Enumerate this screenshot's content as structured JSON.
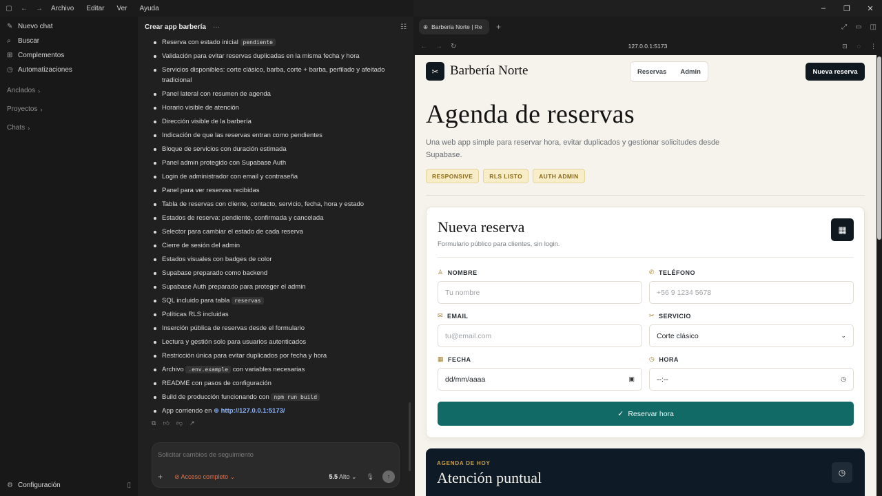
{
  "menubar": {
    "items": [
      "Archivo",
      "Editar",
      "Ver",
      "Ayuda"
    ]
  },
  "sidebar": {
    "items": [
      {
        "label": "Nuevo chat",
        "icon": "edit-icon"
      },
      {
        "label": "Buscar",
        "icon": "search-icon"
      },
      {
        "label": "Complementos",
        "icon": "grid-icon"
      },
      {
        "label": "Automatizaciones",
        "icon": "clock-icon"
      }
    ],
    "sections": [
      "Anclados",
      "Proyectos",
      "Chats"
    ],
    "settings_label": "Configuración"
  },
  "chat": {
    "title": "Crear app barbería",
    "bullets": [
      {
        "text": "Reserva con estado inicial ",
        "code": "pendiente"
      },
      {
        "text": "Validación para evitar reservas duplicadas en la misma fecha y hora"
      },
      {
        "text": "Servicios disponibles: corte clásico, barba, corte + barba, perfilado y afeitado tradicional"
      },
      {
        "text": "Panel lateral con resumen de agenda"
      },
      {
        "text": "Horario visible de atención"
      },
      {
        "text": "Dirección visible de la barbería"
      },
      {
        "text": "Indicación de que las reservas entran como pendientes"
      },
      {
        "text": "Bloque de servicios con duración estimada"
      },
      {
        "text": "Panel admin protegido con Supabase Auth"
      },
      {
        "text": "Login de administrador con email y contraseña"
      },
      {
        "text": "Panel para ver reservas recibidas"
      },
      {
        "text": "Tabla de reservas con cliente, contacto, servicio, fecha, hora y estado"
      },
      {
        "text": "Estados de reserva: pendiente, confirmada y cancelada"
      },
      {
        "text": "Selector para cambiar el estado de cada reserva"
      },
      {
        "text": "Cierre de sesión del admin"
      },
      {
        "text": "Estados visuales con badges de color"
      },
      {
        "text": "Supabase preparado como backend"
      },
      {
        "text": "Supabase Auth preparado para proteger el admin"
      },
      {
        "text": "SQL incluido para tabla ",
        "code": "reservas"
      },
      {
        "text": "Políticas RLS incluidas"
      },
      {
        "text": "Inserción pública de reservas desde el formulario"
      },
      {
        "text": "Lectura y gestión solo para usuarios autenticados"
      },
      {
        "text": "Restricción única para evitar duplicados por fecha y hora"
      },
      {
        "text": "Archivo ",
        "code": ".env.example",
        "after": " con variables necesarias"
      },
      {
        "text": "README con pasos de configuración"
      },
      {
        "text": "Build de producción funcionando con ",
        "code": "npm run build"
      },
      {
        "text": "App corriendo en ",
        "link": "http://127.0.0.1:5173/"
      }
    ],
    "composer": {
      "placeholder": "Solicitar cambios de seguimiento",
      "access": "Acceso completo",
      "model": "5.5",
      "effort": "Alto"
    }
  },
  "browser": {
    "tab_title": "Barbería Norte | Re",
    "url": "127.0.0.1:5173"
  },
  "site": {
    "brand": "Barbería Norte",
    "nav": [
      "Reservas",
      "Admin"
    ],
    "cta": "Nueva reserva",
    "hero_title": "Agenda de reservas",
    "hero_sub": "Una web app simple para reservar hora, evitar duplicados y gestionar solicitudes desde Supabase.",
    "chips": [
      "RESPONSIVE",
      "RLS LISTO",
      "AUTH ADMIN"
    ],
    "form": {
      "title": "Nueva reserva",
      "subtitle": "Formulario público para clientes, sin login.",
      "name_label": "NOMBRE",
      "name_placeholder": "Tu nombre",
      "phone_label": "TELÉFONO",
      "phone_placeholder": "+56 9 1234 5678",
      "email_label": "EMAIL",
      "email_placeholder": "tu@email.com",
      "service_label": "SERVICIO",
      "service_value": "Corte clásico",
      "date_label": "FECHA",
      "date_value": "dd/mm/aaaa",
      "time_label": "HORA",
      "time_value": "--:--",
      "submit": "Reservar hora"
    },
    "today": {
      "eyebrow": "AGENDA DE HOY",
      "title": "Atención puntual"
    }
  },
  "colors": {
    "accent": "#126a66",
    "dark": "#101820",
    "chip": "#f8edc9",
    "page_bg": "#f6f3ec"
  }
}
